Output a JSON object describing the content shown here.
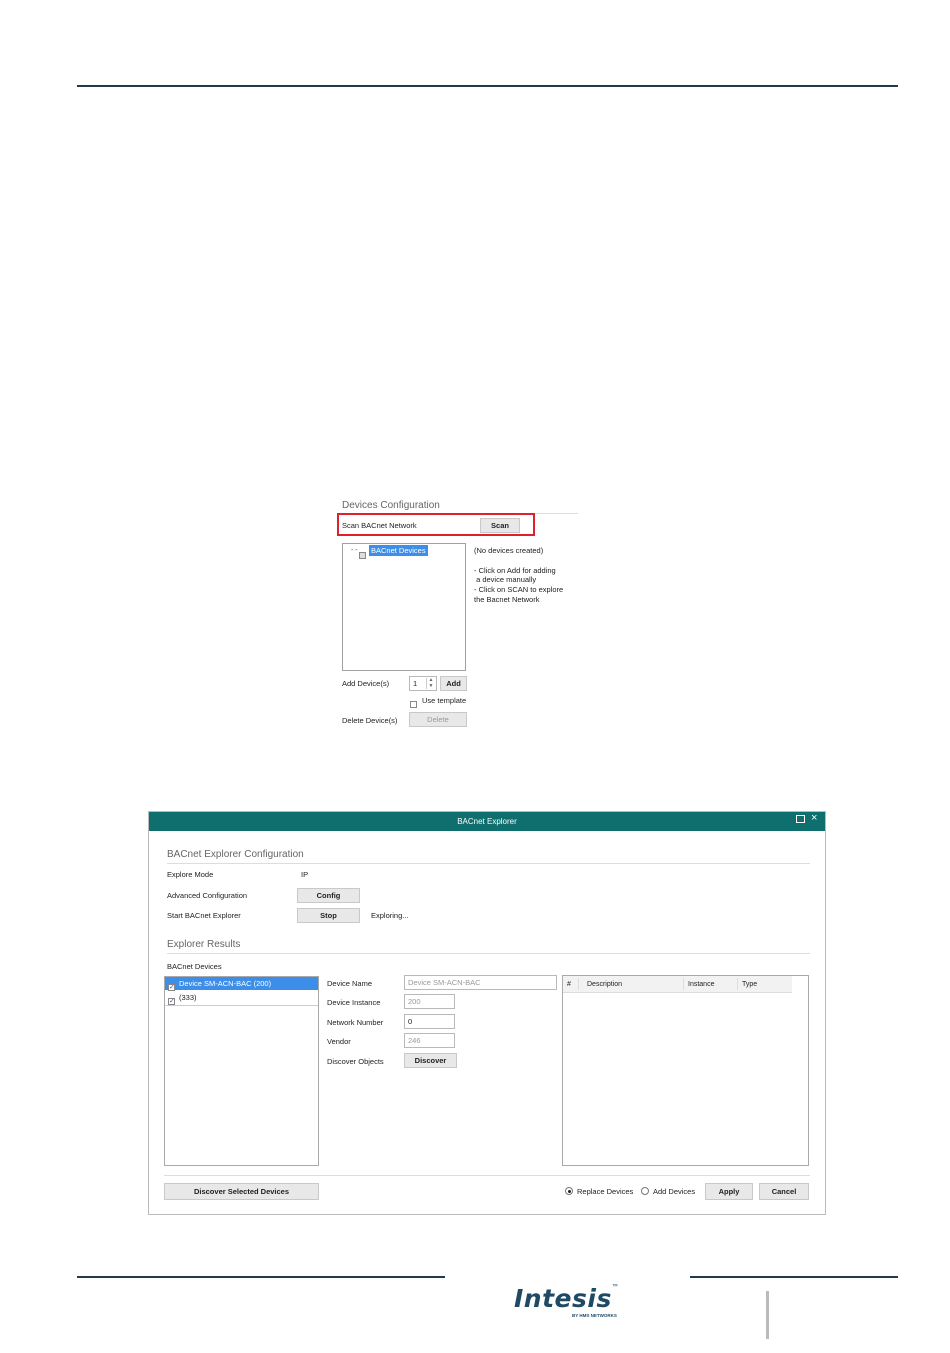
{
  "devices_config": {
    "title": "Devices Configuration",
    "scan_label": "Scan BACnet Network",
    "scan_button": "Scan",
    "tree_prefix": "- -",
    "tree_root": "BACnet Devices",
    "info_lines": [
      "(No devices created)",
      "",
      "- Click on Add for adding",
      " a device manually",
      "- Click on SCAN to explore",
      "the Bacnet Network"
    ],
    "add_label": "Add Device(s)",
    "add_count": "1",
    "add_button": "Add",
    "use_template": "Use template",
    "delete_label": "Delete Device(s)",
    "delete_button": "Delete"
  },
  "explorer": {
    "title": "BACnet Explorer",
    "config_section": "BACnet Explorer Configuration",
    "explore_mode_label": "Explore Mode",
    "explore_mode_value": "IP",
    "advanced_label": "Advanced Configuration",
    "config_button": "Config",
    "start_label": "Start BACnet Explorer",
    "stop_button": "Stop",
    "status": "Exploring...",
    "results_section": "Explorer Results",
    "devices_label": "BACnet Devices",
    "devices": [
      {
        "label": "Device SM-ACN-BAC (200)",
        "selected": true
      },
      {
        "label": "(333)",
        "selected": false
      }
    ],
    "device_name_label": "Device Name",
    "device_name_value": "Device SM-ACN-BAC",
    "device_instance_label": "Device Instance",
    "device_instance_value": "200",
    "network_number_label": "Network Number",
    "network_number_value": "0",
    "vendor_label": "Vendor",
    "vendor_value": "246",
    "discover_objects_label": "Discover Objects",
    "discover_button": "Discover",
    "columns": [
      "#",
      "Description",
      "Instance",
      "Type"
    ],
    "discover_selected_button": "Discover Selected Devices",
    "replace_devices": "Replace Devices",
    "add_devices": "Add Devices",
    "apply_button": "Apply",
    "cancel_button": "Cancel"
  },
  "footer": {
    "brand": "Intesis",
    "tm": "™",
    "tagline": "BY HMS NETWORKS"
  },
  "colors": {
    "header_bar": "#1f3b4d",
    "window_title": "#0f6e6e",
    "highlight_red": "#e0202a",
    "selection_blue": "#3d8ee8"
  }
}
